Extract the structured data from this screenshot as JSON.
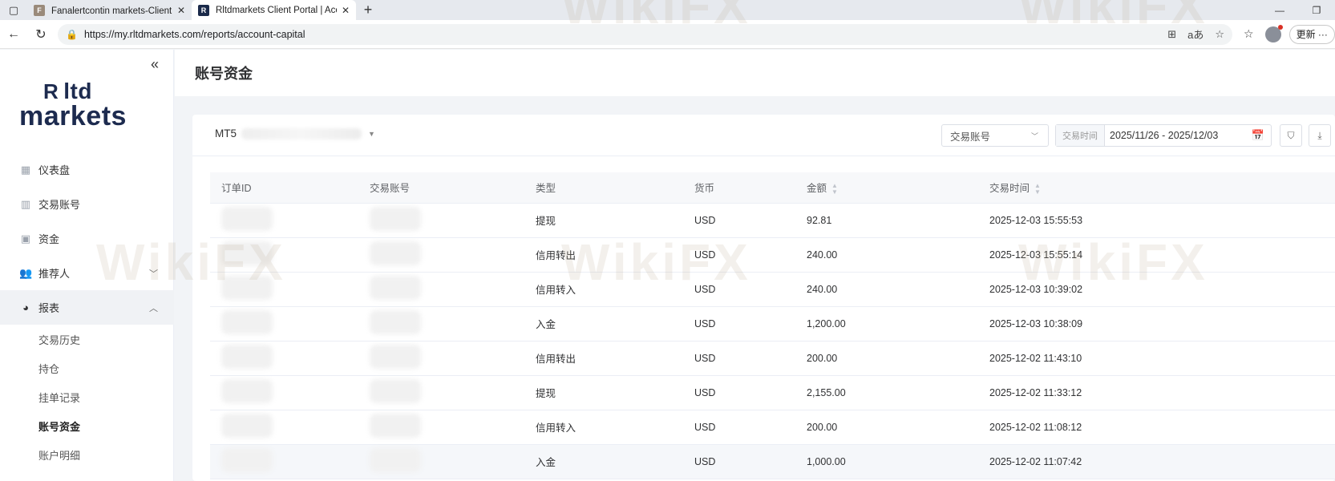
{
  "browser": {
    "tabs": [
      {
        "title": "Fanalertcontin markets-Client 登...",
        "active": false
      },
      {
        "title": "Rltdmarkets Client Portal | Accou",
        "active": true
      }
    ],
    "url": "https://my.rltdmarkets.com/reports/account-capital",
    "update_label": "更新"
  },
  "sidebar": {
    "logo": {
      "line1": "ltd",
      "line2": "markets"
    },
    "menu": [
      {
        "label": "仪表盘",
        "icon": "dashboard-icon"
      },
      {
        "label": "交易账号",
        "icon": "chart-bars-icon"
      },
      {
        "label": "资金",
        "icon": "wallet-icon"
      },
      {
        "label": "推荐人",
        "icon": "users-icon",
        "expandable": true
      },
      {
        "label": "报表",
        "icon": "pie-chart-icon",
        "expanded": true
      }
    ],
    "submenu": [
      {
        "label": "交易历史",
        "active": false
      },
      {
        "label": "持仓",
        "active": false
      },
      {
        "label": "挂单记录",
        "active": false
      },
      {
        "label": "账号资金",
        "active": true
      },
      {
        "label": "账户明细",
        "active": false
      }
    ]
  },
  "page": {
    "title": "账号资金"
  },
  "filters": {
    "account_prefix": "MT5",
    "account_type_placeholder": "交易账号",
    "date_label": "交易时间",
    "date_range": "2025/11/26 - 2025/12/03"
  },
  "table": {
    "headers": [
      "订单ID",
      "交易账号",
      "类型",
      "货币",
      "金额",
      "交易时间"
    ],
    "rows": [
      {
        "type": "提现",
        "currency": "USD",
        "amount": "92.81",
        "sign": "neg",
        "time": "2025-12-03 15:55:53"
      },
      {
        "type": "信用转出",
        "currency": "USD",
        "amount": "240.00",
        "sign": "neg",
        "time": "2025-12-03 15:55:14"
      },
      {
        "type": "信用转入",
        "currency": "USD",
        "amount": "240.00",
        "sign": "pos",
        "time": "2025-12-03 10:39:02"
      },
      {
        "type": "入金",
        "currency": "USD",
        "amount": "1,200.00",
        "sign": "pos",
        "time": "2025-12-03 10:38:09"
      },
      {
        "type": "信用转出",
        "currency": "USD",
        "amount": "200.00",
        "sign": "neg",
        "time": "2025-12-02 11:43:10"
      },
      {
        "type": "提现",
        "currency": "USD",
        "amount": "2,155.00",
        "sign": "neg",
        "time": "2025-12-02 11:33:12"
      },
      {
        "type": "信用转入",
        "currency": "USD",
        "amount": "200.00",
        "sign": "pos",
        "time": "2025-12-02 11:08:12"
      },
      {
        "type": "入金",
        "currency": "USD",
        "amount": "1,000.00",
        "sign": "pos",
        "time": "2025-12-02 11:07:42"
      }
    ]
  },
  "watermark": "WikiFX",
  "colors": {
    "negative": "#e04f4f",
    "positive": "#4caf50",
    "brand": "#1d2b4f"
  }
}
